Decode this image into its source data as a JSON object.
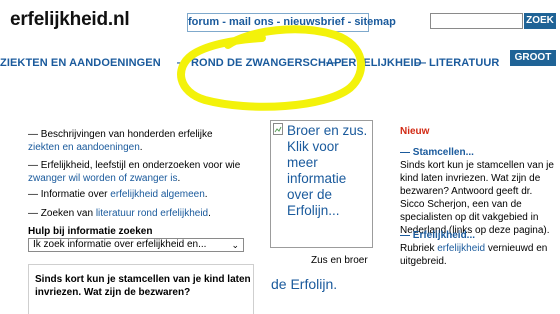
{
  "header": {
    "logo": "erfelijkheid.nl",
    "topnav": {
      "forum": "forum",
      "mail": "mail ons",
      "nieuwsbrief": "nieuwsbrief",
      "sitemap": "sitemap",
      "separator": "-"
    },
    "search_placeholder": "",
    "zoek_label": "ZOEK",
    "groot_label": "GROOT"
  },
  "mainnav": {
    "items": [
      "ZIEKTEN EN AANDOENINGEN",
      "ROND DE ZWANGERSCHAP",
      "ERFELIJKHEID",
      "LITERATUUR"
    ],
    "separator": "—"
  },
  "highlight_color": "#f3f20a",
  "content": {
    "bullets": [
      {
        "prefix": "— Beschrijvingen van honderden erfelijke",
        "link": "ziekten en aandoeningen",
        "suffix": "."
      },
      {
        "prefix": "— Erfelijkheid, leefstijl en onderzoeken voor wie",
        "link": "zwanger wil worden of zwanger is",
        "suffix": "."
      },
      {
        "prefix": "— Informatie over",
        "link": "erfelijkheid algemeen",
        "suffix": "."
      },
      {
        "prefix": "— Zoeken van",
        "link": "literatuur rond erfelijkheid",
        "suffix": "."
      }
    ],
    "hulp_label": "Hulp bij informatie zoeken",
    "hulp_select": "Ik zoek informatie over erfelijkheid en...",
    "faq_question": "Sinds kort kun je stamcellen van je kind laten invriezen. Wat zijn de bezwaren?",
    "image_alt": "Broer en zus. Klik voor meer informatie over de Erfolijn...",
    "image_caption": "Zus en broer",
    "erfolijn": "de Erfolijn."
  },
  "news": {
    "heading": "Nieuw",
    "items": [
      {
        "title": "— Stamcellen...",
        "body": "Sinds kort kun je stamcellen van je kind laten invriezen. Wat zijn de bezwaren? Antwoord geeft dr. Sicco Scherjon, een van de specialisten op dit vakgebied in Nederland (links op deze pagina)."
      },
      {
        "title": "— Erfelijkheid...",
        "body_prefix": "Rubriek",
        "body_link": "erfelijkheid",
        "body_suffix": "vernieuwd en uitgebreid."
      }
    ]
  }
}
